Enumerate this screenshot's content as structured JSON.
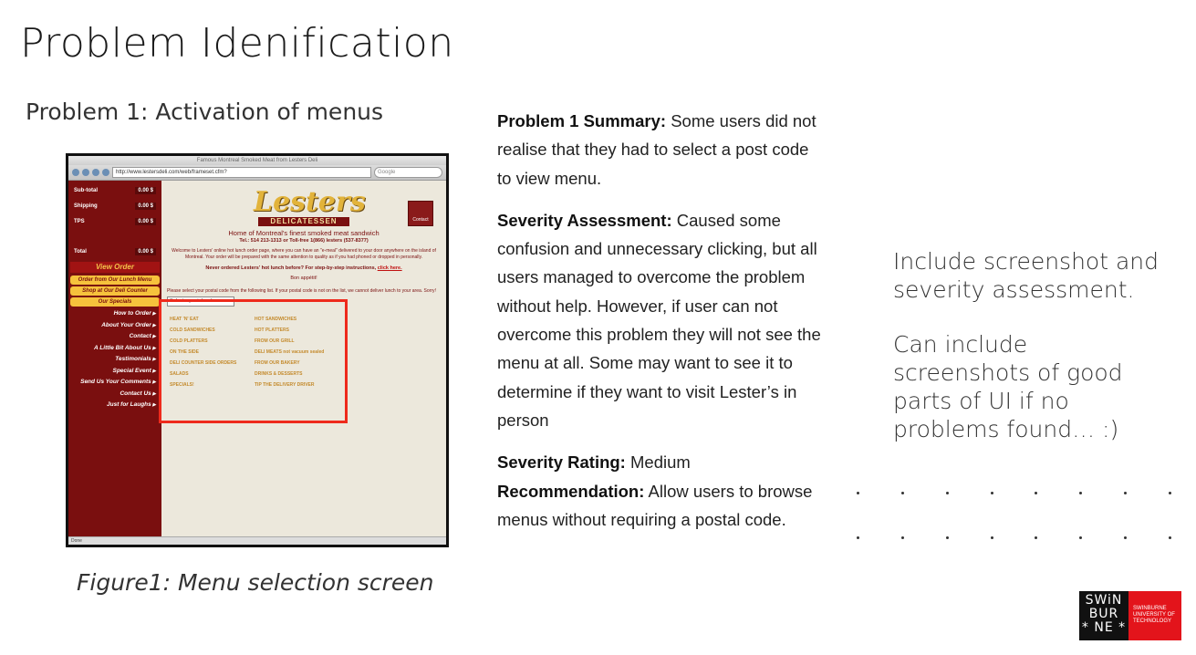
{
  "slide": {
    "title": "Problem Idenification",
    "subtitle": "Problem 1: Activation of menus",
    "caption": "Figure1: Menu selection screen"
  },
  "screenshot": {
    "window_title": "Famous Montreal Smoked Meat from Lesters Deli",
    "url": "http://www.lestersdeli.com/web/frameset.cfm?",
    "search_placeholder": "Google",
    "cart": [
      {
        "label": "Sub-total",
        "value": "0.00 $"
      },
      {
        "label": "Shipping",
        "value": "0.00 $"
      },
      {
        "label": "TPS",
        "value": "0.00 $"
      },
      {
        "label": "Total",
        "value": "0.00 $"
      }
    ],
    "view_order": "View Order",
    "order_pills": [
      "Order from Our Lunch Menu",
      "Shop at Our Deli Counter",
      "Our Specials"
    ],
    "nav_links": [
      "How to Order",
      "About Your Order",
      "Contact",
      "A Little Bit About Us",
      "Testimonials",
      "Special Event",
      "Send Us Your Comments",
      "Contact Us",
      "Just for Laughs"
    ],
    "logo": "Lesters",
    "deli": "DELICATESSEN",
    "contact_badge": "Contact",
    "tagline": "Home of Montreal's finest smoked meat sandwich",
    "phone": "Tel.: 514 213-1313 or Toll-free 1(866) lesters (537-8377)",
    "welcome": "Welcome to Lesters' online hot lunch order page, where you can have an \"e-meal\" delivered to your door anywhere on the island of Montreal. Your order will be prepared with the same attention to quality as if you had phoned or dropped in personally.",
    "never_text": "Never ordered Lesters' hot lunch before? For step-by-step instructions,",
    "never_link": "click here.",
    "bon": "Bon appétit!",
    "please": "Please select your postal code from the following list. If your postal code is not on the list, we cannot deliver lunch to your area. Sorry!",
    "postal_select": "Select a postal code",
    "menu_items": [
      "HEAT 'N' EAT",
      "HOT SANDWICHES",
      "COLD SANDWICHES",
      "HOT PLATTERS",
      "COLD PLATTERS",
      "FROM OUR GRILL",
      "ON THE SIDE",
      "DELI MEATS not vacuum sealed",
      "DELI COUNTER SIDE ORDERS",
      "FROM OUR BAKERY",
      "SALADS",
      "DRINKS & DESSERTS",
      "SPECIALS!",
      "TIP THE DELIVERY DRIVER"
    ],
    "status": "Done"
  },
  "summary": {
    "p1_label": "Problem 1 Summary:",
    "p1_text": " Some users did not realise that they had to select a post code to view menu.",
    "sev_label": "Severity Assessment:",
    "sev_text": " Caused some confusion and unnecessary clicking, but all users managed to overcome the problem without help. However, if user can not overcome this problem they will not see the menu at all. Some may want to see it to determine if they want to visit Lester’s in person",
    "rating_label": "Severity Rating:",
    "rating_text": " Medium",
    "rec_label": "Recommendation:",
    "rec_text": " Allow users to browse menus without requiring a postal code."
  },
  "note": {
    "line1": "Include screenshot and severity assessment.",
    "line2": "Can include screenshots of good parts of UI if no problems found… :)"
  },
  "logo": {
    "mark_line1": "SWiN",
    "mark_line2": "BUR",
    "mark_line3": "* NE *",
    "name": "SWINBURNE UNIVERSITY OF TECHNOLOGY"
  }
}
